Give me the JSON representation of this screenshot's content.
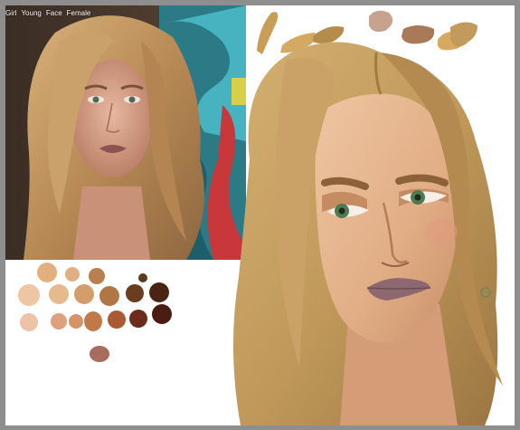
{
  "photo": {
    "tags": [
      "Girl",
      "Young",
      "Face",
      "Female"
    ]
  },
  "palette": {
    "swatch_colors": [
      "#e2b07e",
      "#dfae82",
      "#b8804e",
      "#5d3a1e",
      "#efc6a4",
      "#e7b98e",
      "#d39e6c",
      "#b07644",
      "#6a3d20",
      "#4a2412",
      "#edc3a8",
      "#dfa07e",
      "#d59466",
      "#c07a4a",
      "#a95a32",
      "#6b2c1b",
      "#4a1c12",
      "#a86b5d"
    ],
    "stroke_colors": [
      "#c99d55",
      "#d4aa62",
      "#b78c4a",
      "#c7a28f",
      "#a97a58",
      "#d7a860",
      "#c29a5c"
    ]
  },
  "colors": {
    "frame": "#8e8e8e",
    "hair": "#c19a5b",
    "skin": "#e1ad85",
    "eyes": "#4f7a52",
    "lips": "#8d6870"
  }
}
